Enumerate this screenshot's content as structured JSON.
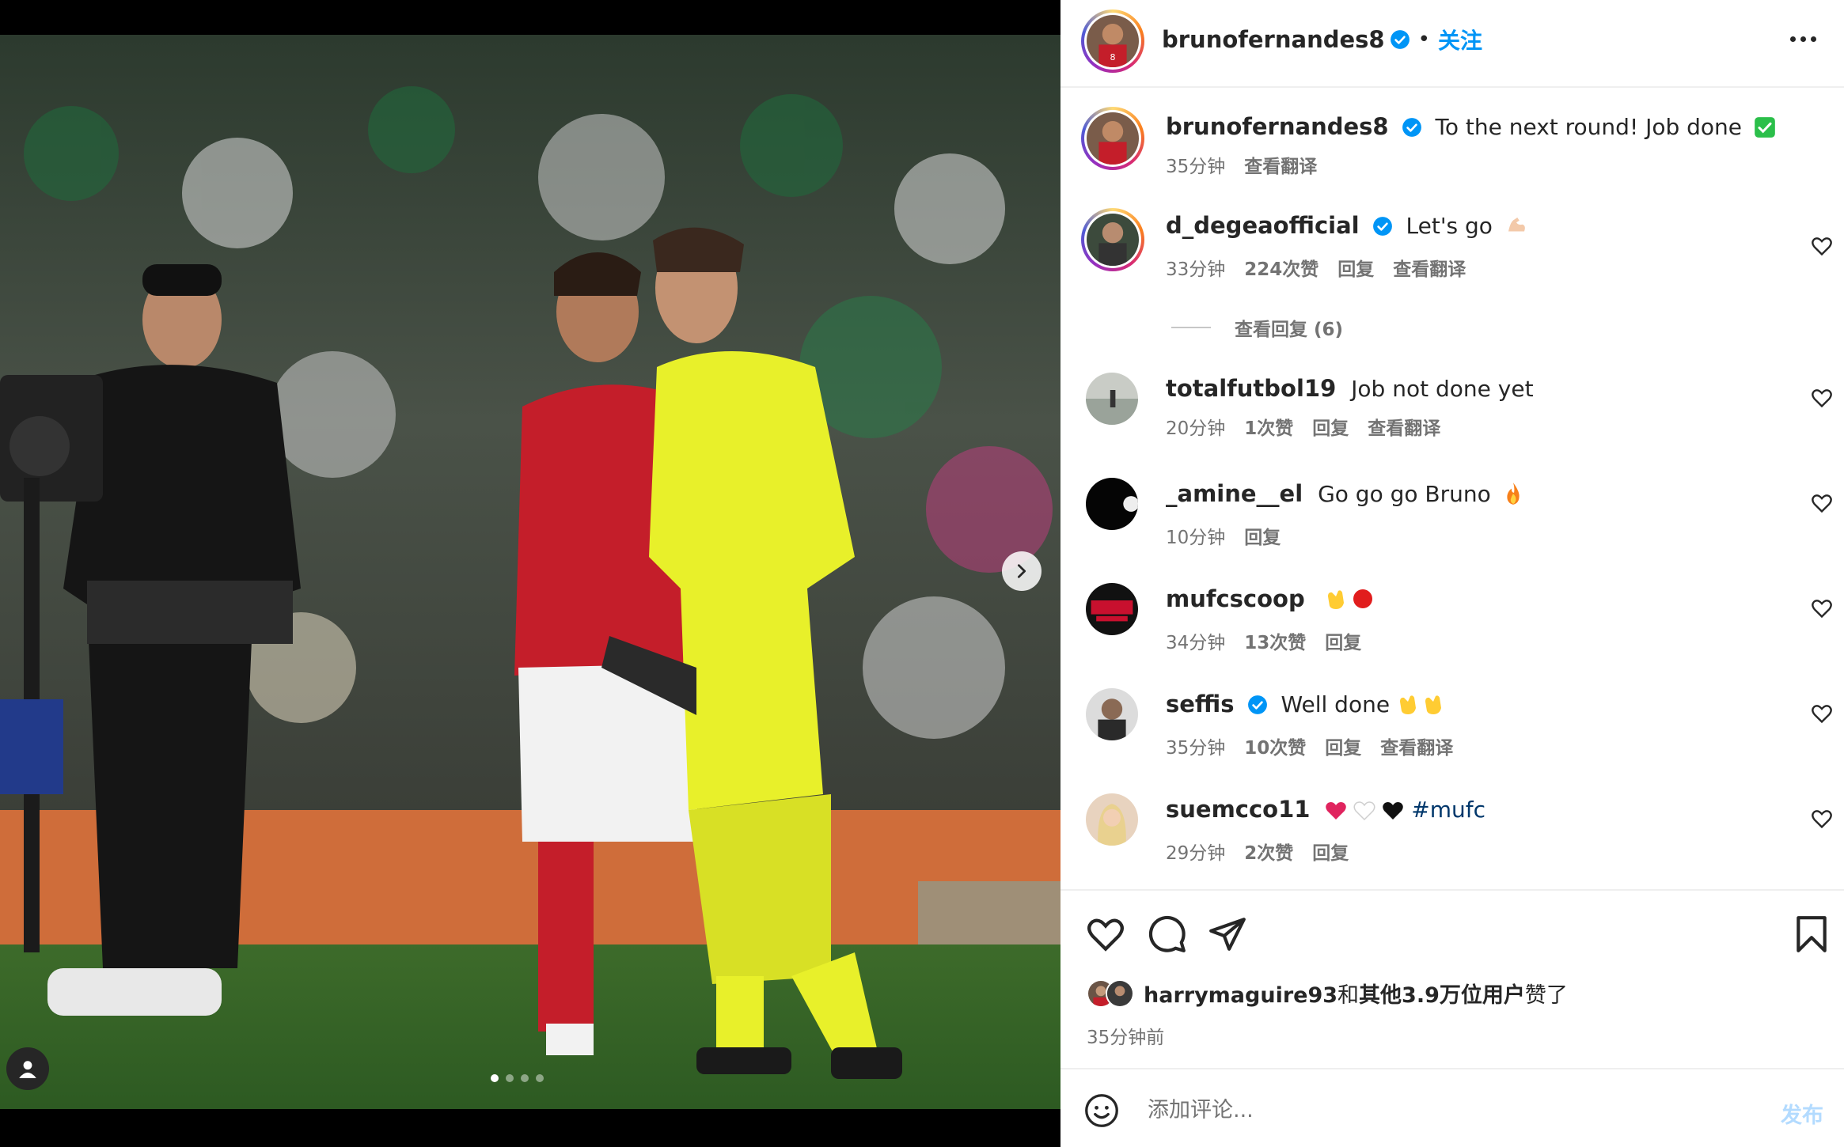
{
  "post": {
    "author": "brunofernandes8",
    "follow_label": "关注",
    "separator": "•",
    "caption": {
      "username": "brunofernandes8",
      "text": "To the next round! Job done",
      "time": "35分钟",
      "translate": "查看翻译",
      "emoji": "green-check-emoji"
    },
    "carousel": {
      "slide": 1,
      "slide_count": 4
    }
  },
  "comments": [
    {
      "username": "d_degeaofficial",
      "verified": true,
      "text": "Let's go",
      "emoji": "flexed-biceps-emoji",
      "time": "33分钟",
      "likes": "224次赞",
      "reply": "回复",
      "translate": "查看翻译",
      "view_replies": "查看回复 (6)"
    },
    {
      "username": "totalfutbol19",
      "verified": false,
      "text": "Job not done yet",
      "time": "20分钟",
      "likes": "1次赞",
      "reply": "回复",
      "translate": "查看翻译"
    },
    {
      "username": "_amine__el",
      "verified": false,
      "text": "Go go go Bruno",
      "emoji": "fire-emoji",
      "time": "10分钟",
      "reply": "回复"
    },
    {
      "username": "mufcscoop",
      "verified": false,
      "text": "",
      "emoji": "clapping-red-circle-emoji",
      "time": "34分钟",
      "likes": "13次赞",
      "reply": "回复"
    },
    {
      "username": "seffis",
      "verified": true,
      "text": "Well done",
      "emoji": "clapping-hands-emoji",
      "time": "35分钟",
      "likes": "10次赞",
      "reply": "回复",
      "translate": "查看翻译"
    },
    {
      "username": "suemcco11",
      "verified": false,
      "text": "",
      "hashtag": "#mufc",
      "emoji": "hearts-emoji",
      "time": "29分钟",
      "likes": "2次赞",
      "reply": "回复"
    }
  ],
  "likes_summary": {
    "user": "harrymaguire93",
    "joiner": "和",
    "others": "其他3.9万位用户",
    "suffix": "赞了"
  },
  "posted_ago": "35分钟前",
  "composer": {
    "placeholder": "添加评论...",
    "post_label": "发布"
  },
  "icons": [
    "heart-icon",
    "comment-icon",
    "share-icon",
    "bookmark-icon",
    "emoji-icon",
    "more-icon",
    "verified-icon",
    "chevron-right-icon",
    "user-tag-icon"
  ],
  "colors": {
    "accent": "#0095f6",
    "verified": "#0095f6",
    "muted": "#737373",
    "post_disabled": "#b3dbff"
  }
}
